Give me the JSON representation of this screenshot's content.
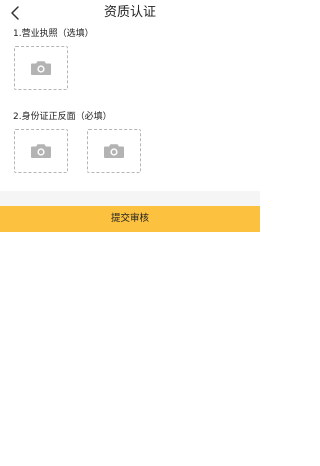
{
  "header": {
    "title": "资质认证",
    "back_icon": "chevron-left-icon"
  },
  "sections": [
    {
      "label": "1.营业执照（选填）",
      "slots": [
        {
          "icon": "camera-icon"
        }
      ]
    },
    {
      "label": "2.身份证正反面（必填）",
      "slots": [
        {
          "icon": "camera-icon"
        },
        {
          "icon": "camera-icon"
        }
      ]
    }
  ],
  "submit": {
    "label": "提交审核"
  },
  "colors": {
    "accent": "#fcc13f",
    "dashed_border": "#b5b5b5",
    "icon": "#b3b3b3",
    "divider_bg": "#f5f5f5"
  }
}
